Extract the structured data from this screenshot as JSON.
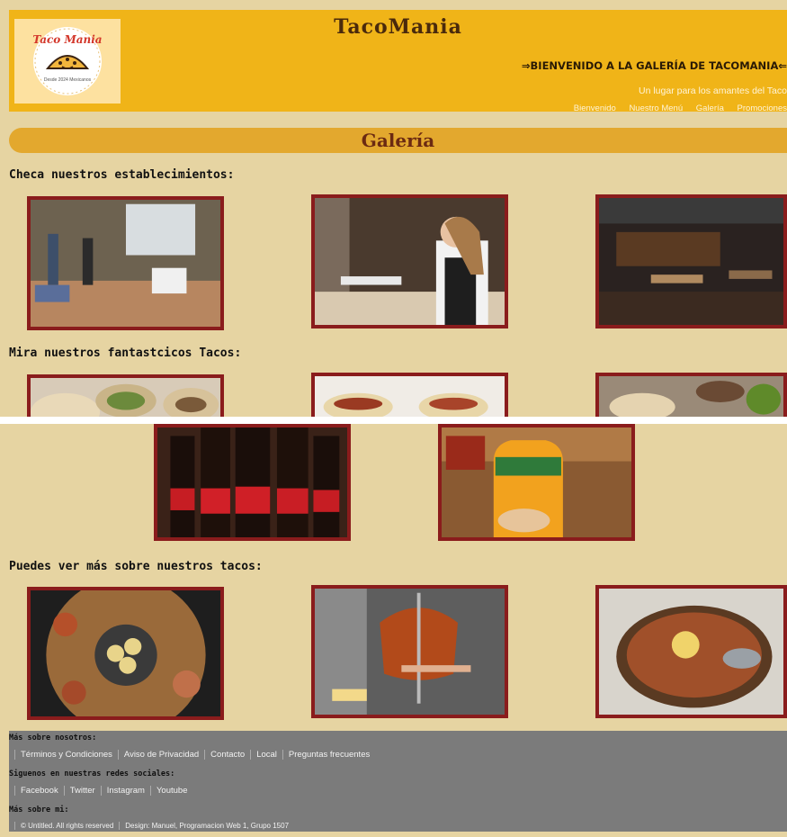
{
  "header": {
    "logo_text": "Taco Mania",
    "logo_subtitle": "Desde 2024 Mexicanos",
    "title": "TacoMania",
    "welcome": "⇒BIENVENIDO A LA GALERÍA DE TACOMANIA⇐",
    "tagline": "Un lugar para los amantes del Taco",
    "nav": [
      "Bienvenido",
      "Nuestro Menú",
      "Galería",
      "Promociones"
    ]
  },
  "gallery": {
    "title": "Galería"
  },
  "sections": [
    "Checa nuestros establecimientos:",
    "Mira nuestros fantastcicos Tacos:",
    "Puedes ver más sobre nuestros tacos:"
  ],
  "footer": {
    "about_title": "Más sobre nosotros:",
    "about_links": [
      "Términos y Condiciones",
      "Aviso de Privacidad",
      "Contacto",
      "Local",
      "Preguntas frecuentes"
    ],
    "social_title": "Siguenos en nuestras redes sociales:",
    "social_links": [
      "Facebook",
      "Twitter",
      "Instagram",
      "Youtube"
    ],
    "me_title": "Más sobre mi:",
    "credits": [
      "© Untitled. All rights reserved",
      "Design: Manuel, Programacion Web 1, Grupo 1507"
    ]
  },
  "colors": {
    "accent": "#f0b418",
    "background": "#e6d4a2",
    "frame": "#8a1c1c",
    "footer": "#7b7b7b"
  }
}
